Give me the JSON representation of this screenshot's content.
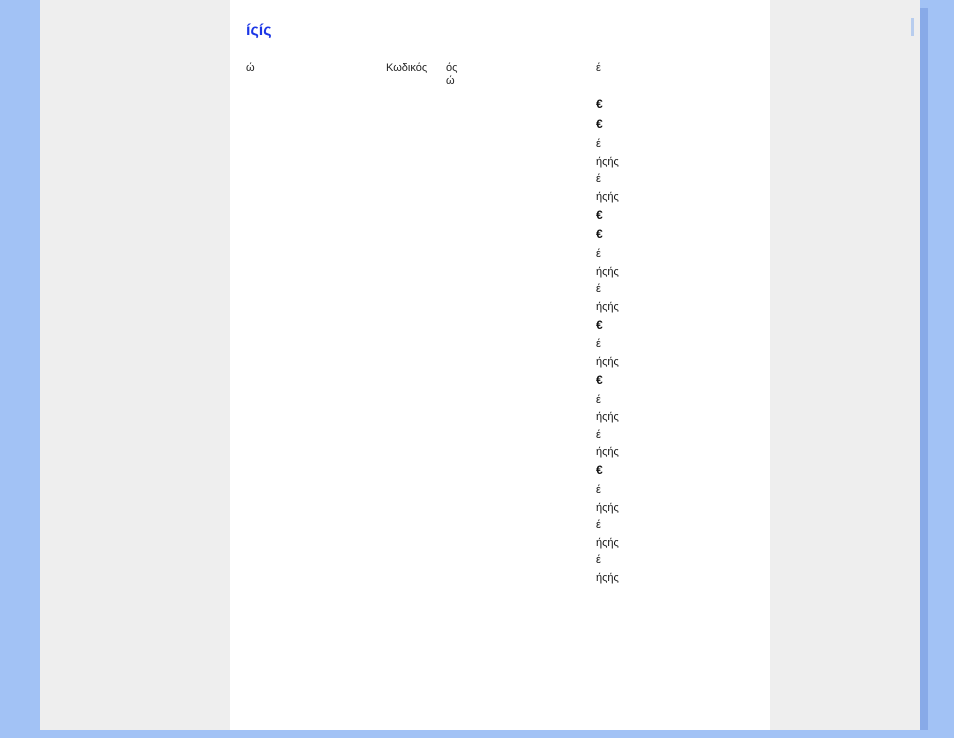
{
  "heading": "íςíς",
  "header": {
    "col1": "ώ",
    "col2": "Κωδικός",
    "col3a": "ός",
    "col3b": "ώ",
    "col4": "έ"
  },
  "entries": [
    {
      "bold": true,
      "text": "€"
    },
    {
      "bold": true,
      "text": "€"
    },
    {
      "bold": false,
      "text": "έ"
    },
    {
      "bold": false,
      "text": "ήςής"
    },
    {
      "bold": false,
      "text": "έ"
    },
    {
      "bold": false,
      "text": "ήςής"
    },
    {
      "bold": true,
      "text": "€"
    },
    {
      "bold": true,
      "text": "€"
    },
    {
      "bold": false,
      "text": "έ"
    },
    {
      "bold": false,
      "text": "ήςής"
    },
    {
      "bold": false,
      "text": "έ"
    },
    {
      "bold": false,
      "text": "ήςής"
    },
    {
      "bold": true,
      "text": "€"
    },
    {
      "bold": false,
      "text": "έ"
    },
    {
      "bold": false,
      "text": "ήςής"
    },
    {
      "bold": true,
      "text": "€"
    },
    {
      "bold": false,
      "text": "έ"
    },
    {
      "bold": false,
      "text": "ήςής"
    },
    {
      "bold": false,
      "text": "έ"
    },
    {
      "bold": false,
      "text": "ήςής"
    },
    {
      "bold": true,
      "text": "€"
    },
    {
      "bold": false,
      "text": "έ"
    },
    {
      "bold": false,
      "text": "ήςής"
    },
    {
      "bold": false,
      "text": "έ"
    },
    {
      "bold": false,
      "text": "ήςής"
    },
    {
      "bold": false,
      "text": "έ"
    },
    {
      "bold": false,
      "text": "ήςής"
    }
  ]
}
